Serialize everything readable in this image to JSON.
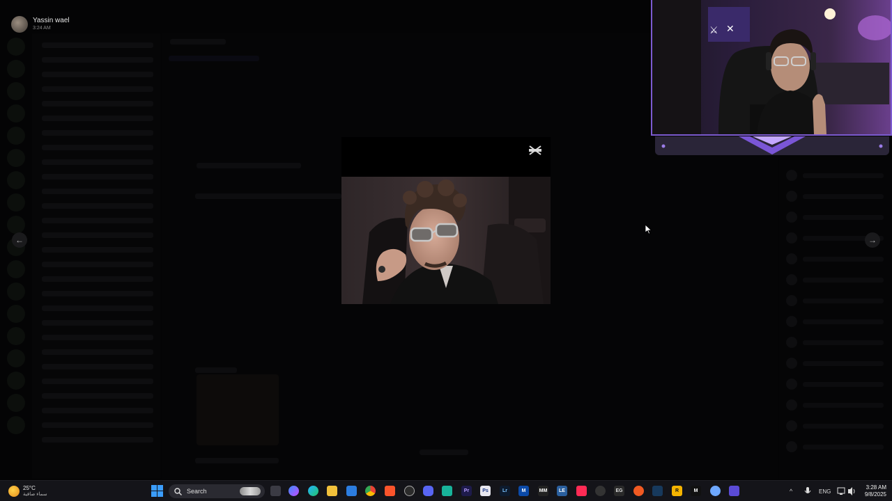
{
  "viewer": {
    "user_name": "Yassin wael",
    "post_time": "3:24 AM",
    "prev_arrow": "←",
    "next_arrow": "→",
    "media_icon": "capcut-icon"
  },
  "taskbar": {
    "weather": {
      "temp": "25°C",
      "condition": "سماء صافية",
      "icon": "sun-cloud-icon"
    },
    "search_label": "Search",
    "pinned_icons": [
      "task-view-icon",
      "copilot-icon",
      "edge-icon",
      "file-explorer-icon",
      "store-icon",
      "chrome-icon",
      "brave-icon",
      "chatgpt-icon",
      "discord-icon",
      "capcut-icon",
      "premiere-icon",
      "photoshop-icon",
      "lightroom-icon",
      "mail-icon",
      "mm-icon",
      "le-icon",
      "davinci-icon",
      "obs-icon",
      "epic-icon",
      "origin-icon",
      "steam-icon",
      "rockstar-icon",
      "m-icon",
      "app-icon",
      "gamepad-icon"
    ],
    "tray": {
      "caret": "^",
      "language": "ENG",
      "time": "3:28 AM",
      "date": "9/8/2025"
    }
  },
  "colors": {
    "accent_webcam": "#7c5bd0",
    "windows_blue": "#3b9dfc",
    "discord_blurple": "#5865f2"
  }
}
